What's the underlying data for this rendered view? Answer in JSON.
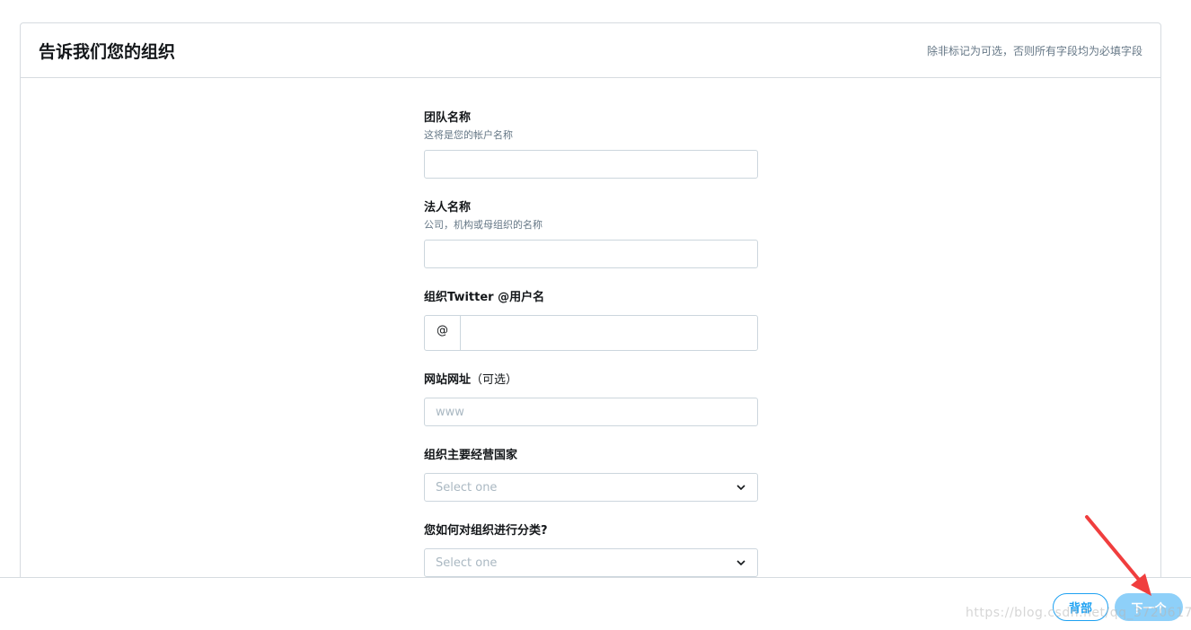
{
  "header": {
    "title": "告诉我们您的组织",
    "note": "除非标记为可选，否则所有字段均为必填字段"
  },
  "fields": {
    "team_name": {
      "label": "团队名称",
      "help": "这将是您的帐户名称",
      "value": ""
    },
    "legal_name": {
      "label": "法人名称",
      "help": "公司，机构或母组织的名称",
      "value": ""
    },
    "twitter": {
      "label": "组织Twitter @用户名",
      "prefix": "@",
      "value": ""
    },
    "website": {
      "label": "网站网址",
      "optional": "（可选）",
      "placeholder": "www"
    },
    "country": {
      "label": "组织主要经营国家",
      "selected": "Select one"
    },
    "category": {
      "label": "您如何对组织进行分类?",
      "selected": "Select one"
    }
  },
  "footer": {
    "back_label": "背部",
    "next_label": "下一个"
  },
  "watermark": "https://blog.csdn.net/qq_37206171",
  "colors": {
    "accent": "#1da1f2",
    "annotation_arrow": "#f03e3e"
  },
  "icons": {
    "dropdown": "chevron-down-icon",
    "annotation": "arrow-icon"
  }
}
